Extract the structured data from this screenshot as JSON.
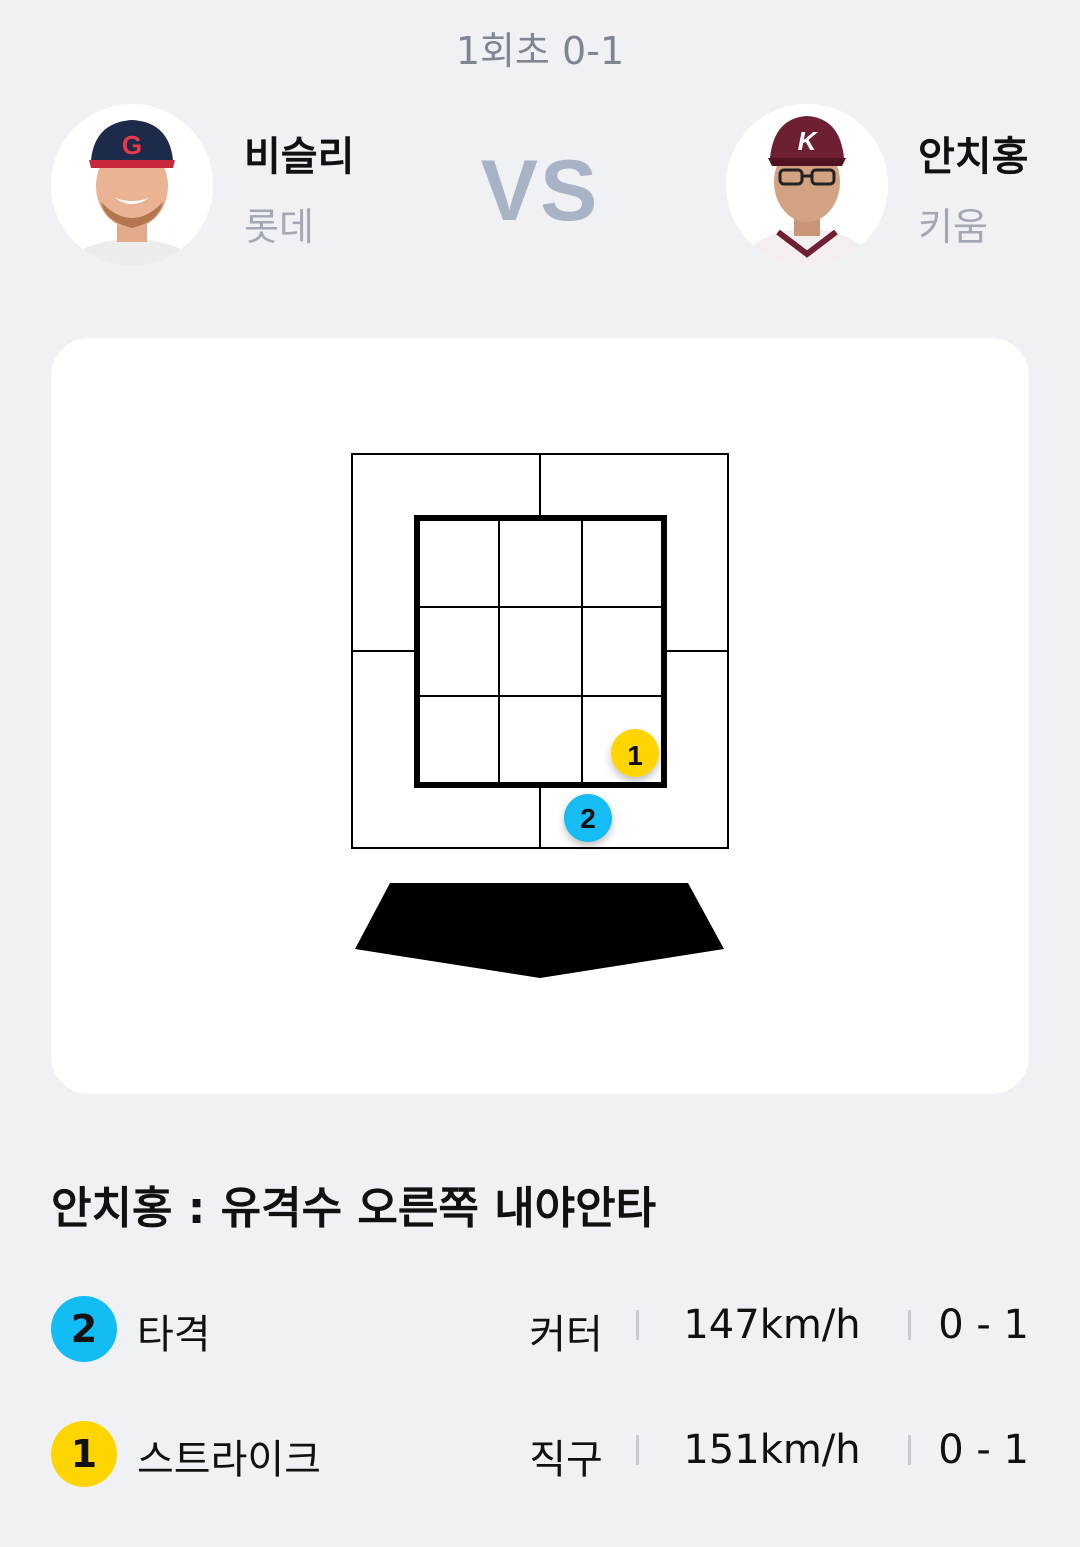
{
  "header": {
    "inning": "1회초 0-1"
  },
  "vs_label": "VS",
  "pitcher": {
    "name": "비슬리",
    "team": "롯데",
    "cap_letter": "G",
    "cap_color": "#1d2a4a"
  },
  "batter": {
    "name": "안치홍",
    "team": "키움",
    "cap_letter": "K",
    "cap_color": "#6e1f32"
  },
  "strike_zone": {
    "pitches": [
      {
        "number": "1",
        "color": "#ffd500"
      },
      {
        "number": "2",
        "color": "#12bdf5"
      }
    ]
  },
  "result_text": "안치홍 : 유격수 오른쪽 내야안타",
  "pitch_log": [
    {
      "number": "2",
      "color": "#12bdf5",
      "result": "타격",
      "pitch_type": "커터",
      "speed": "147km/h",
      "count": "0 - 1"
    },
    {
      "number": "1",
      "color": "#ffd500",
      "result": "스트라이크",
      "pitch_type": "직구",
      "speed": "151km/h",
      "count": "0 - 1"
    }
  ]
}
